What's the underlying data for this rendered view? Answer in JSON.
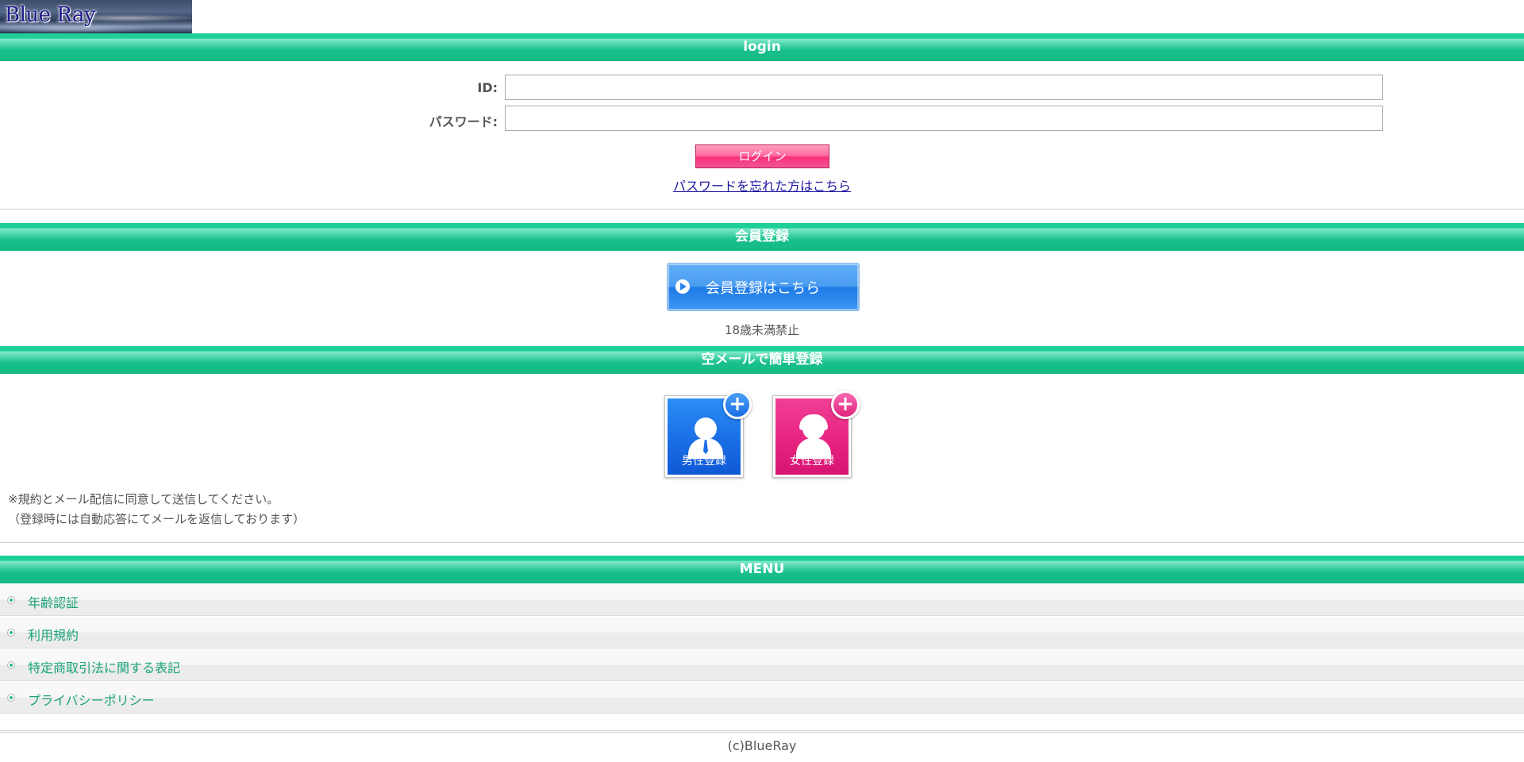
{
  "logo": {
    "text": "Blue Ray"
  },
  "login_section": {
    "header": "login",
    "id_label": "ID:",
    "id_value": "",
    "password_label": "パスワード:",
    "password_value": "",
    "login_button": "ログイン",
    "forgot_link": "パスワードを忘れた方はこちら"
  },
  "register_section": {
    "header": "会員登録",
    "register_button": "会員登録はこちら",
    "age_notice": "18歳未満禁止"
  },
  "email_register_section": {
    "header": "空メールで簡単登録",
    "male_label": "男性登録",
    "female_label": "女性登録",
    "note_line1": "※規約とメール配信に同意して送信してください。",
    "note_line2": "（登録時には自動応答にてメールを返信しております）"
  },
  "menu": {
    "header": "MENU",
    "items": [
      {
        "label": "年齢認証"
      },
      {
        "label": "利用規約"
      },
      {
        "label": "特定商取引法に関する表記"
      },
      {
        "label": "プライバシーポリシー"
      }
    ]
  },
  "footer": {
    "copyright": "(c)BlueRay"
  },
  "colors": {
    "bar": "#1fcf98",
    "menu_text": "#1aa37a",
    "login_button": "#f7317a",
    "male": "#1a6ee6",
    "female": "#e82481",
    "link": "#1b15a0"
  },
  "icons": {
    "play": "play-circle-icon",
    "plus": "plus-circle-icon",
    "bullet": "radio-bullet-icon"
  }
}
